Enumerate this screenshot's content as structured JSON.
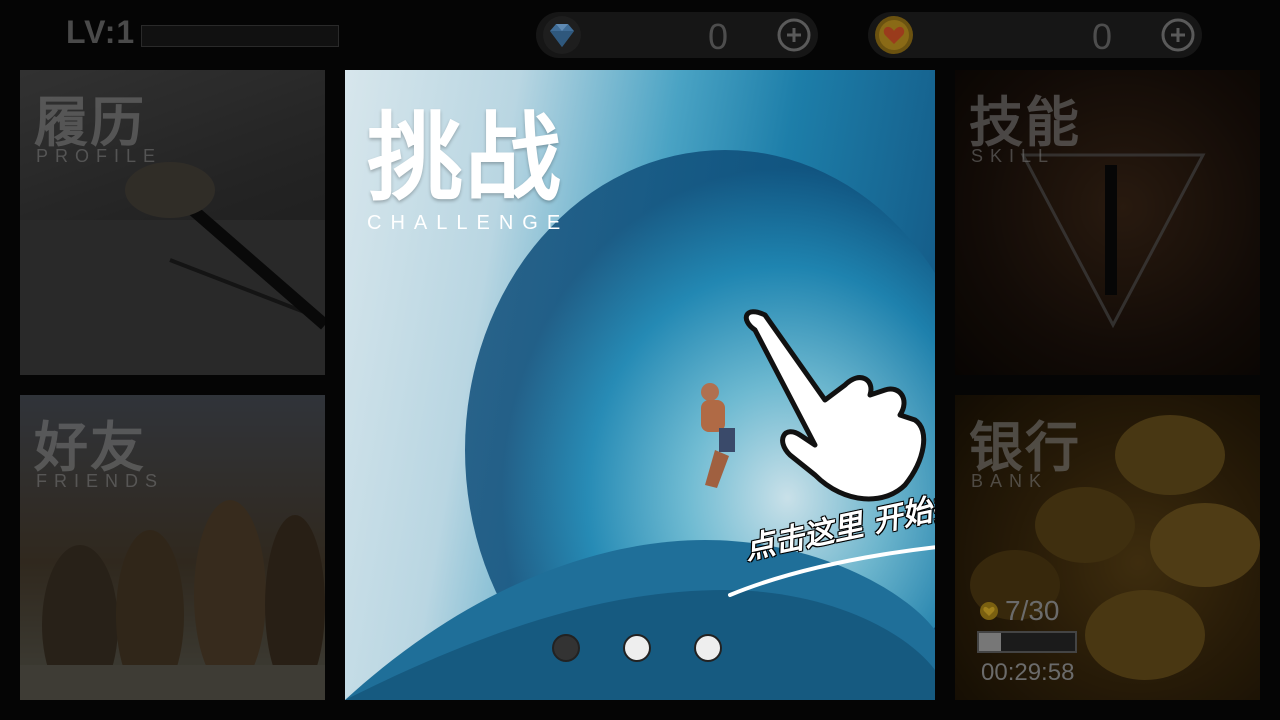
{
  "level": {
    "label": "LV:1",
    "xp_progress": 0
  },
  "currencies": {
    "gems": {
      "icon": "diamond-icon",
      "value": "0",
      "accent": "#4a90d9"
    },
    "hearts": {
      "icon": "heart-coin-icon",
      "value": "0",
      "accent": "#d4a020"
    }
  },
  "tiles": {
    "profile": {
      "title": "履历",
      "subtitle": "PROFILE"
    },
    "friends": {
      "title": "好友",
      "subtitle": "FRIENDS"
    },
    "skills": {
      "title": "技能",
      "subtitle": "SKILL"
    },
    "bank": {
      "title": "银行",
      "subtitle": "BANK",
      "count": "7/30",
      "count_progress": 0.23,
      "timer": "00:29:58"
    }
  },
  "main": {
    "title": "挑战",
    "subtitle": "CHALLENGE",
    "cta": "点击这里 开始挑战",
    "pager": {
      "total": 3,
      "active": 0
    }
  }
}
